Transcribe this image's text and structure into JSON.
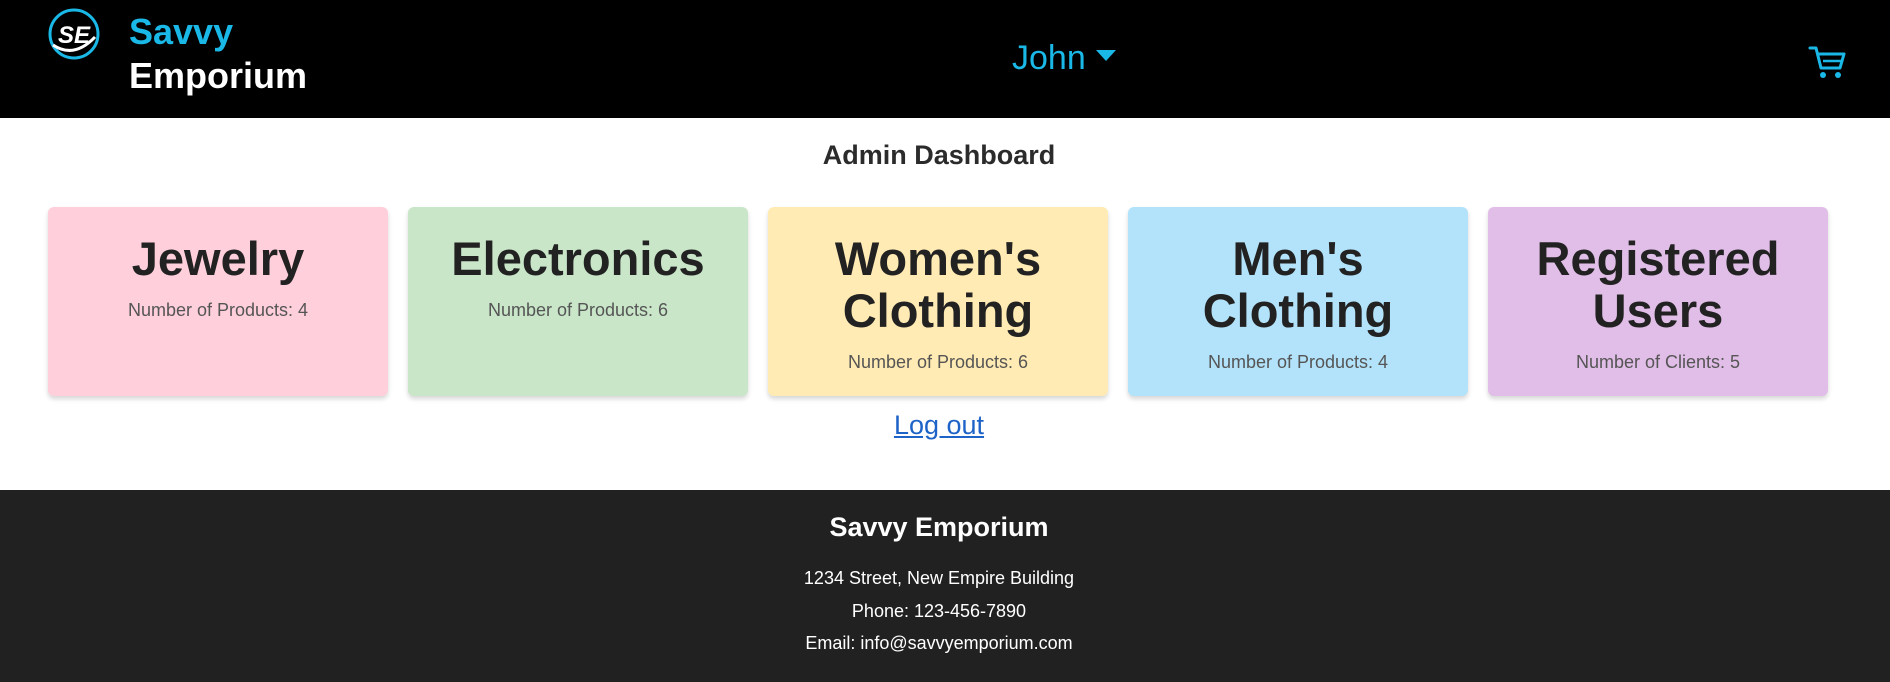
{
  "header": {
    "logo_text": "SE",
    "brand_line1": "Savvy",
    "brand_line2": "Emporium",
    "user_name": "John",
    "cart_icon": "cart-icon"
  },
  "main": {
    "title": "Admin Dashboard",
    "cards": [
      {
        "title": "Jewelry",
        "count_text": "Number of Products: 4",
        "color": "#ffd0dc"
      },
      {
        "title": "Electronics",
        "count_text": "Number of Products: 6",
        "color": "#c9e6c9"
      },
      {
        "title": "Women's Clothing",
        "count_text": "Number of Products: 6",
        "color": "#ffebb3"
      },
      {
        "title": "Men's Clothing",
        "count_text": "Number of Products: 4",
        "color": "#b3e3fa"
      },
      {
        "title": "Registered Users",
        "count_text": "Number of Clients: 5",
        "color": "#e1bee7"
      }
    ],
    "logout_label": "Log out"
  },
  "footer": {
    "title": "Savvy Emporium",
    "address": "1234 Street, New Empire Building",
    "phone": "Phone: 123-456-7890",
    "email": "Email: info@savvyemporium.com"
  },
  "colors": {
    "accent": "#1ab8e6",
    "header_bg": "#000000",
    "footer_bg": "#212121",
    "link": "#1e63c7"
  }
}
